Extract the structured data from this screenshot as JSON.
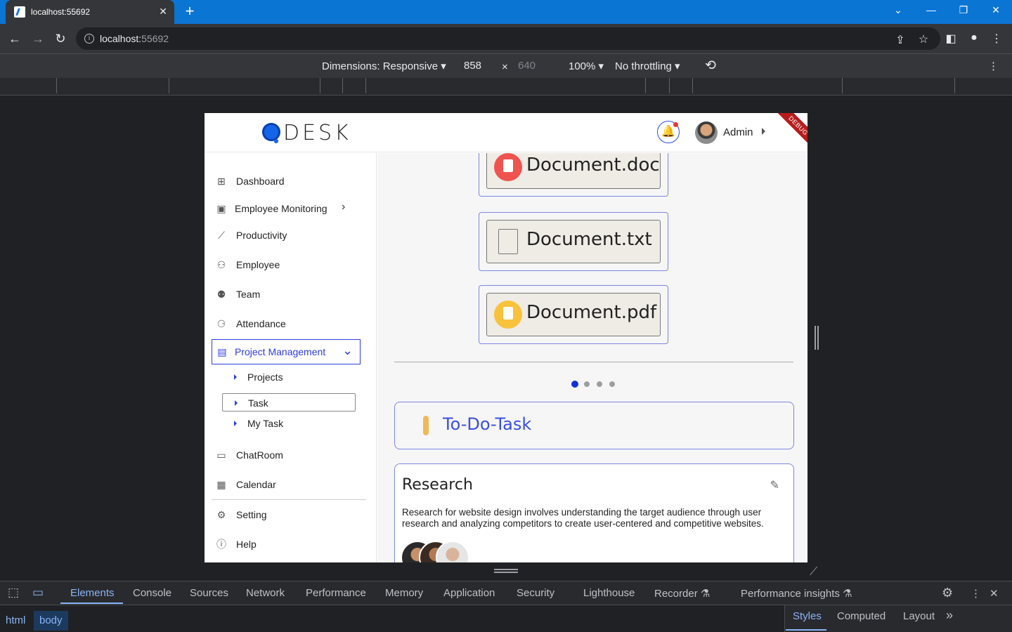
{
  "browser": {
    "tab_title": "localhost:55692",
    "url_host": "localhost:",
    "url_port": "55692"
  },
  "device_toolbar": {
    "dimensions": "Dimensions: Responsive",
    "width": "858",
    "times": "×",
    "height": "640",
    "zoom": "100%",
    "throttling": "No throttling"
  },
  "app": {
    "logo_text": "DESK",
    "admin_name": "Admin",
    "debug_label": "DEBUG",
    "sidebar": {
      "items": [
        {
          "label": "Dashboard",
          "icon": "grid-icon"
        },
        {
          "label": "Employee Monitoring",
          "icon": "monitor-icon"
        },
        {
          "label": "Productivity",
          "icon": "chart-icon"
        },
        {
          "label": "Employee",
          "icon": "person-icon"
        },
        {
          "label": "Team",
          "icon": "team-icon"
        },
        {
          "label": "Attendance",
          "icon": "attendance-icon"
        },
        {
          "label": "Project Management",
          "icon": "folder-icon"
        },
        {
          "label": "ChatRoom",
          "icon": "chat-icon"
        },
        {
          "label": "Calendar",
          "icon": "calendar-icon"
        },
        {
          "label": "Setting",
          "icon": "gear-icon"
        },
        {
          "label": "Help",
          "icon": "help-icon"
        }
      ],
      "sub_items": [
        "Projects",
        "Task",
        "My Task"
      ]
    },
    "documents": [
      "Document.doc",
      "Document.txt",
      "Document.pdf"
    ],
    "carousel_active_index": 0,
    "carousel_count": 4,
    "todo_title": "To-Do-Task",
    "card": {
      "title": "Research",
      "description": "Research for website design involves understanding the target audience through user research and analyzing competitors to create user-centered and competitive websites."
    }
  },
  "devtools": {
    "tabs": [
      "Elements",
      "Console",
      "Sources",
      "Network",
      "Performance",
      "Memory",
      "Application",
      "Security",
      "Lighthouse",
      "Recorder",
      "Performance insights"
    ],
    "active_tab": "Elements",
    "breadcrumbs": [
      "html",
      "body"
    ],
    "side_tabs": [
      "Styles",
      "Computed",
      "Layout"
    ]
  }
}
